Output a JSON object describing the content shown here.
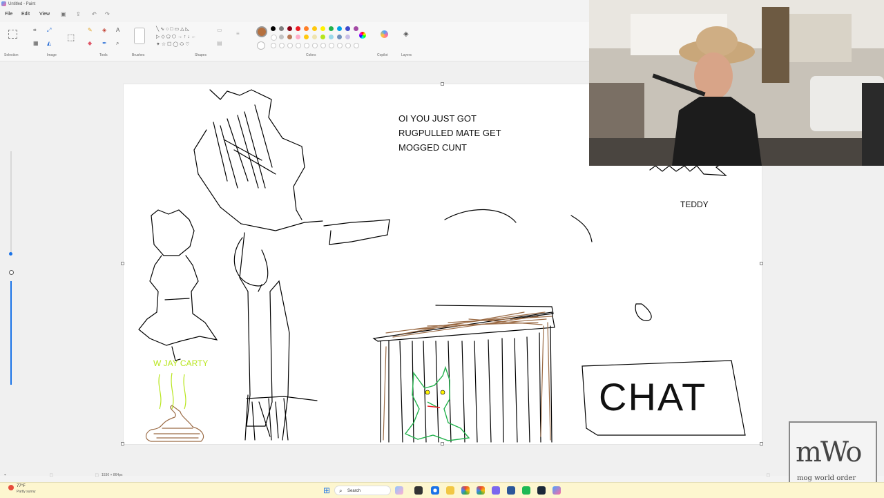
{
  "window": {
    "title": "Untitled - Paint"
  },
  "menu": {
    "file": "File",
    "edit": "Edit",
    "view": "View"
  },
  "ribbon": {
    "groups": {
      "selection": "Selection",
      "image": "Image",
      "tools": "Tools",
      "brushes": "Brushes",
      "shapes": "Shapes",
      "colors": "Colors",
      "copilot": "Copilot",
      "layers": "Layers"
    },
    "active_color": "#b5703f",
    "palette_row1": [
      "#000000",
      "#7f7f7f",
      "#880015",
      "#ed1c24",
      "#ff7f27",
      "#ffc90e",
      "#fff200",
      "#22b14c",
      "#00a2e8",
      "#3f48cc",
      "#a349a4"
    ],
    "palette_row2": [
      "#ffffff",
      "#c3c3c3",
      "#b97a57",
      "#ffaec9",
      "#ffc90e",
      "#efe4b0",
      "#b5e61d",
      "#99d9ea",
      "#7092be",
      "#c8bfe7"
    ]
  },
  "canvas_text": {
    "headline": [
      "OI YOU JUST GOT",
      "RUGPULLED MATE GET",
      "MOGGED CUNT"
    ],
    "teddy": "TEDDY",
    "jay": "W JAY CARTY",
    "chat": "CHAT"
  },
  "status": {
    "dimensions": "1536 × 864px"
  },
  "weather": {
    "temp": "77°F",
    "desc": "Partly sunny"
  },
  "taskbar": {
    "search_placeholder": "Search"
  },
  "overlay_logo": {
    "line1": "mWo",
    "line2": "mog world order"
  }
}
